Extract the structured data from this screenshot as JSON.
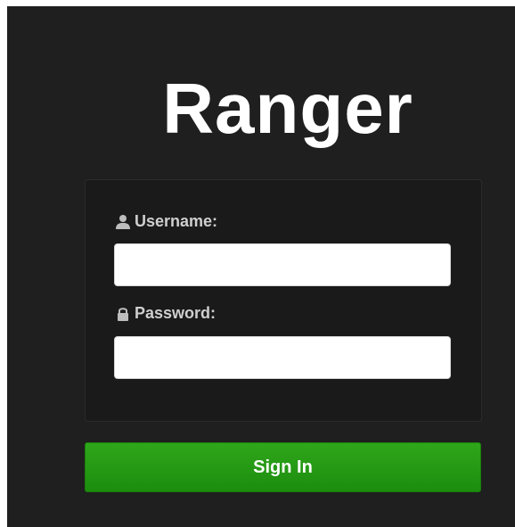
{
  "app": {
    "logo_text": "Ranger"
  },
  "login": {
    "username_label": "Username:",
    "username_value": "",
    "password_label": "Password:",
    "password_value": "",
    "username_icon": "user-icon",
    "password_icon": "lock-icon",
    "signin_label": "Sign In"
  },
  "colors": {
    "background": "#1f1f1f",
    "panel": "#1a1a1a",
    "button": "#1f9511",
    "text": "#ffffff"
  }
}
